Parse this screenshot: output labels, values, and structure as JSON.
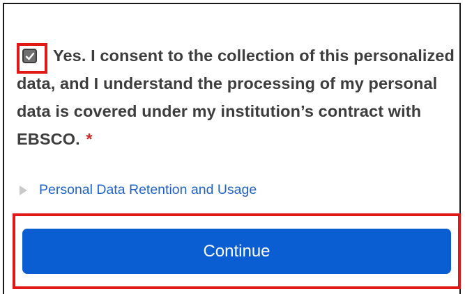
{
  "consent": {
    "checkbox_icon": "checkmark-icon",
    "checked": true,
    "text": "Yes. I consent to the collection of this personalized data, and I understand the processing of my personal data is covered under my institution’s contract with EBSCO.",
    "required_marker": "*"
  },
  "disclosure": {
    "icon": "triangle-right-icon",
    "label": "Personal Data Retention and Usage"
  },
  "actions": {
    "continue_label": "Continue"
  },
  "colors": {
    "primary_button": "#0b5ed1",
    "link": "#1f62c9",
    "required": "#d8262a",
    "highlight": "#e01818"
  }
}
